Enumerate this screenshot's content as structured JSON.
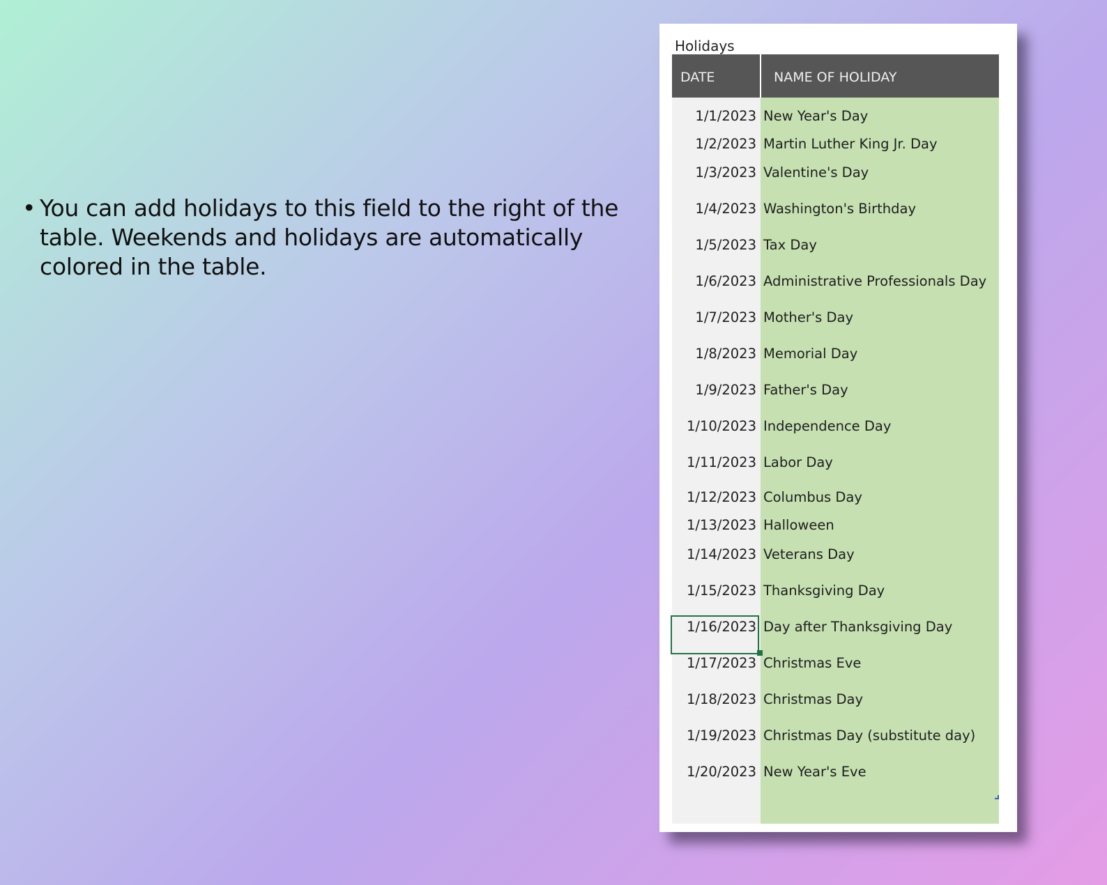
{
  "description": {
    "text": "You can add holidays to this field to the right of the table. Weekends and holidays are automatically colored in the table."
  },
  "sheet": {
    "title": "Holidays",
    "columns": {
      "date": "DATE",
      "name": "NAME OF HOLIDAY"
    },
    "rows": [
      {
        "date": "1/1/2023",
        "name": "New Year's Day"
      },
      {
        "date": "1/2/2023",
        "name": "Martin Luther King Jr. Day"
      },
      {
        "date": "1/3/2023",
        "name": "Valentine's Day"
      },
      {
        "date": "1/4/2023",
        "name": "Washington's Birthday"
      },
      {
        "date": "1/5/2023",
        "name": "Tax Day"
      },
      {
        "date": "1/6/2023",
        "name": "Administrative Professionals Day"
      },
      {
        "date": "1/7/2023",
        "name": "Mother's Day"
      },
      {
        "date": "1/8/2023",
        "name": "Memorial Day"
      },
      {
        "date": "1/9/2023",
        "name": "Father's Day"
      },
      {
        "date": "1/10/2023",
        "name": "Independence Day"
      },
      {
        "date": "1/11/2023",
        "name": "Labor Day"
      },
      {
        "date": "1/12/2023",
        "name": "Columbus Day"
      },
      {
        "date": "1/13/2023",
        "name": "Halloween"
      },
      {
        "date": "1/14/2023",
        "name": "Veterans Day"
      },
      {
        "date": "1/15/2023",
        "name": "Thanksgiving Day"
      },
      {
        "date": "1/16/2023",
        "name": "Day after Thanksgiving Day"
      },
      {
        "date": "1/17/2023",
        "name": "Christmas Eve"
      },
      {
        "date": "1/18/2023",
        "name": "Christmas Day"
      },
      {
        "date": "1/19/2023",
        "name": "Christmas Day (substitute day)"
      },
      {
        "date": "1/20/2023",
        "name": "New Year's Eve"
      }
    ],
    "selected_row": 15,
    "colors": {
      "header_bg": "#565656",
      "date_col_bg": "#f1f1f1",
      "holiday_col_bg": "#c6e0b2",
      "selection_border": "#217346"
    }
  }
}
